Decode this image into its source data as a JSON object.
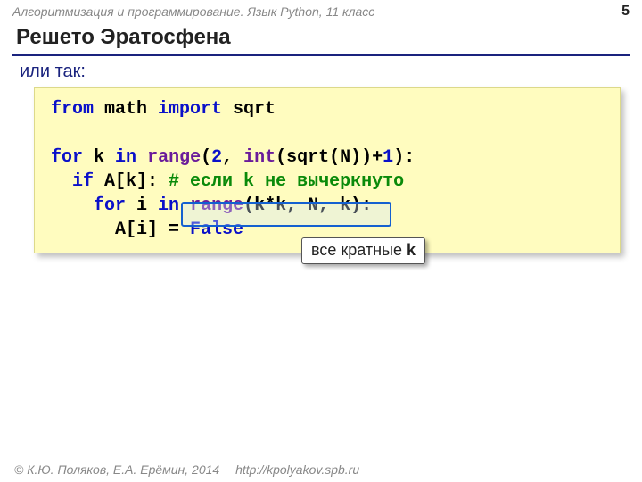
{
  "header": {
    "course_line": "Алгоритмизация и программирование. Язык Python, 11 класс",
    "page_number": "5"
  },
  "title": "Решето Эратосфена",
  "subtitle": "или так:",
  "code": {
    "l1_from": "from",
    "l1_math": " math ",
    "l1_import": "import",
    "l1_sqrt": " sqrt",
    "l2_for": "for",
    "l2_k": " k ",
    "l2_in": "in",
    "l2_sp": " ",
    "l2_range": "range",
    "l2_paren1": "(",
    "l2_two": "2",
    "l2_mid": ", ",
    "l2_int": "int",
    "l2_sqrtcall": "(sqrt(N))+",
    "l2_one": "1",
    "l2_end": "):",
    "l3_indent": "  ",
    "l3_if": "if",
    "l3_cond": " A[k]: ",
    "l3_cmt": "# если k не вычеркнуто",
    "l4_indent": "    ",
    "l4_for": "for",
    "l4_i": " i ",
    "l4_in": "in",
    "l4_sp": " ",
    "l4_range": "range",
    "l4_args": "(k*k, N, k)",
    "l4_colon": ":",
    "l5_indent": "      ",
    "l5_body": "A[i] = ",
    "l5_false": "False"
  },
  "callout": {
    "pre": "все кратные ",
    "bold": "k"
  },
  "footer": {
    "copyright": "© К.Ю. Поляков, Е.А. Ерёмин, 2014",
    "url": "http://kpolyakov.spb.ru"
  }
}
